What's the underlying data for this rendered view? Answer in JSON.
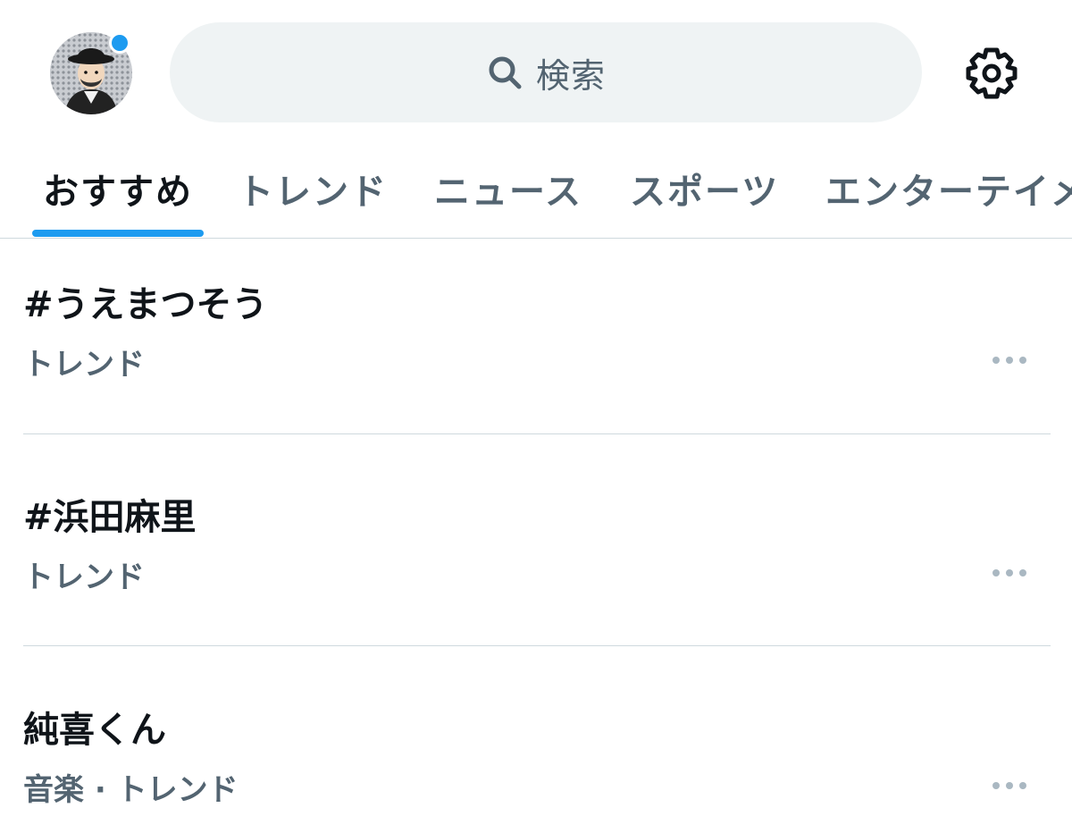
{
  "header": {
    "avatar_icon": "user-avatar",
    "notification_color": "#1d9bf0",
    "search": {
      "icon": "search-icon",
      "placeholder": "検索"
    },
    "settings_icon": "gear-icon"
  },
  "tabs": [
    {
      "label": "おすすめ",
      "active": true
    },
    {
      "label": "トレンド",
      "active": false
    },
    {
      "label": "ニュース",
      "active": false
    },
    {
      "label": "スポーツ",
      "active": false
    },
    {
      "label": "エンターテイメ",
      "active": false
    }
  ],
  "accent_color": "#1d9bf0",
  "trends": [
    {
      "title": "#うえまつそう",
      "meta": "トレンド"
    },
    {
      "title": "#浜田麻里",
      "meta": "トレンド"
    },
    {
      "title": "純喜くん",
      "meta": "音楽 · トレンド"
    }
  ],
  "more_icon": "more-dots-icon"
}
